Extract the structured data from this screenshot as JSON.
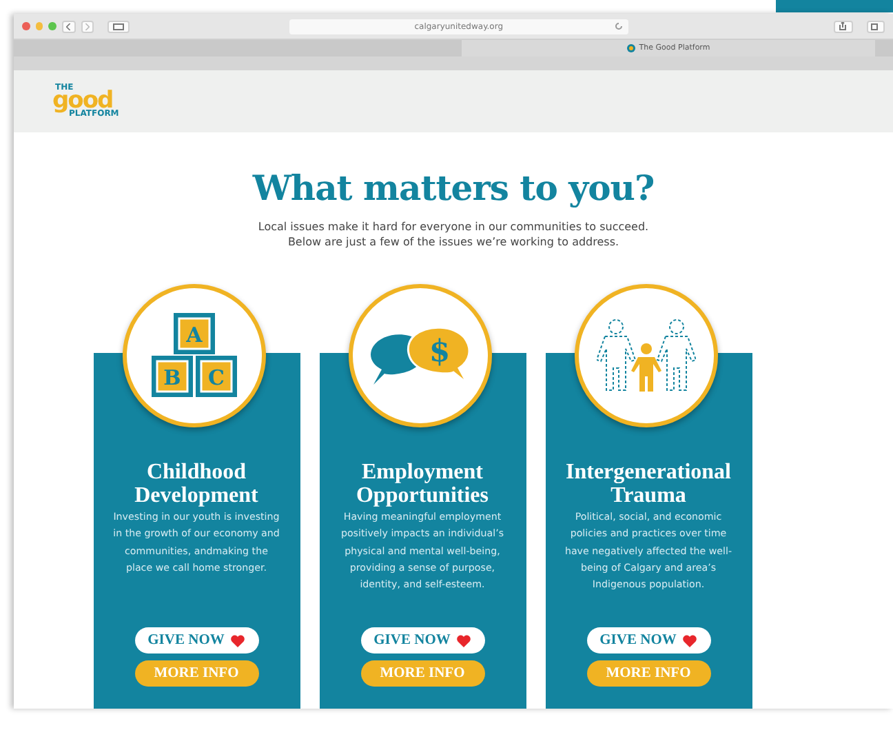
{
  "browser": {
    "url": "calgaryunitedway.org",
    "tab": {
      "title": "The Good Platform"
    }
  },
  "logo": {
    "top": "THE",
    "word": "good",
    "bottom": "PLATFORM"
  },
  "heading": "What matters to you?",
  "intro": [
    "Local issues make it hard for everyone in our communities to succeed.",
    "Below are just a few of the issues we’re working to address."
  ],
  "cards": [
    {
      "kind": "blocks",
      "icon_text": [
        "A",
        "B",
        "C"
      ],
      "title": "Childhood Development",
      "body": "Investing in our youth is investing in the growth of our economy and communities, andmaking the place we call home stronger.",
      "give": "GIVE NOW",
      "more": "MORE INFO"
    },
    {
      "kind": "money",
      "icon_text": [
        "$"
      ],
      "title": "Employment Opportunities",
      "body": "Having meaningful employment positively impacts an individual’s physical and mental well-being, providing a sense of purpose, identity, and self-esteem.",
      "give": "GIVE NOW",
      "more": "MORE INFO"
    },
    {
      "kind": "family",
      "title": "Intergenerational Trauma",
      "body": "Political, social, and economic policies and practices over time have negatively affected the well-being of Calgary and area’s Indigenous population.",
      "give": "GIVE NOW",
      "more": "MORE INFO"
    }
  ]
}
